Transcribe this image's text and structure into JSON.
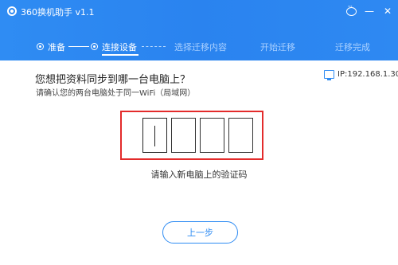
{
  "app": {
    "title": "360换机助手 v1.1"
  },
  "titlebar": {
    "feedback_icon": "chat-bubble-icon",
    "minimize_icon": "minimize-icon",
    "close_icon": "close-icon"
  },
  "steps": [
    {
      "label": "准备",
      "state": "done"
    },
    {
      "label": "连接设备",
      "state": "active"
    },
    {
      "label": "选择迁移内容",
      "state": "pending"
    },
    {
      "label": "开始迁移",
      "state": "pending"
    },
    {
      "label": "迁移完成",
      "state": "pending"
    }
  ],
  "main": {
    "question": "您想把资料同步到哪一台电脑上？",
    "sub_question": "请确认您的两台电脑处于同一WiFi（局域网）",
    "ip_label": "IP:192.168.1.30",
    "code_hint": "请输入新电脑上的验证码",
    "code_digits": [
      "",
      "",
      "",
      ""
    ],
    "prev_button": "上一步"
  },
  "colors": {
    "accent": "#2f8cf3",
    "highlight_border": "#e32b2b"
  }
}
